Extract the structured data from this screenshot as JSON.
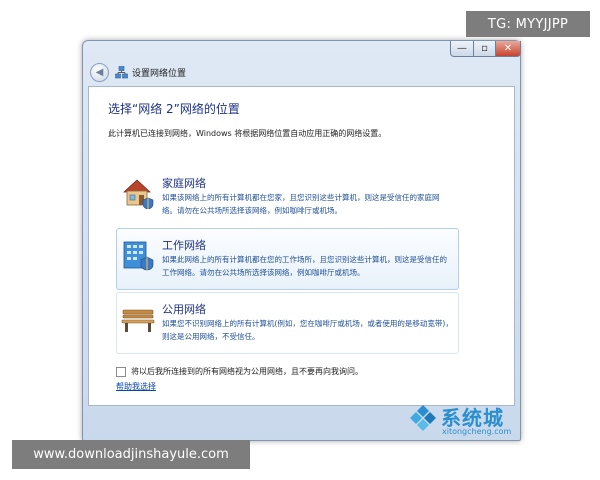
{
  "window": {
    "title": "设置网络位置",
    "controls": {
      "minimize": "—",
      "maximize": "▫",
      "close": "✕"
    }
  },
  "content": {
    "heading": "选择“网络  2”网络的位置",
    "description": "此计算机已连接到网络，Windows 将根据网络位置自动应用正确的网络设置。",
    "options": [
      {
        "title": "家庭网络",
        "text": "如果该网络上的所有计算机都在您家，且您识别这些计算机，则这是受信任的家庭网络。请勿在公共场所选择该网络，例如咖啡厅或机场。",
        "icon": "house-icon"
      },
      {
        "title": "工作网络",
        "text": "如果此网络上的所有计算机都在您的工作场所，且您识别这些计算机，则这是受信任的工作网络。请勿在公共场所选择该网络，例如咖啡厅或机场。",
        "icon": "office-icon"
      },
      {
        "title": "公用网络",
        "text": "如果您不识别网络上的所有计算机(例如，您在咖啡厅或机场，或者使用的是移动宽带)，则这是公用网络，不受信任。",
        "icon": "park-bench-icon"
      }
    ],
    "checkbox_label": "将以后我所连接到的所有网络视为公用网络，且不要再向我询问。",
    "help_link": "帮助我选择"
  },
  "overlays": {
    "top_right_tag": "TG: MYYJJPP",
    "bottom_left_watermark": "www.downloadjinshayule.com",
    "logo_brand": "系统城",
    "logo_url": "xitongcheng.com"
  },
  "colors": {
    "heading": "#1e3287",
    "link": "#0645ad",
    "logo": "#2a8fd0",
    "close": "#c7432f"
  }
}
